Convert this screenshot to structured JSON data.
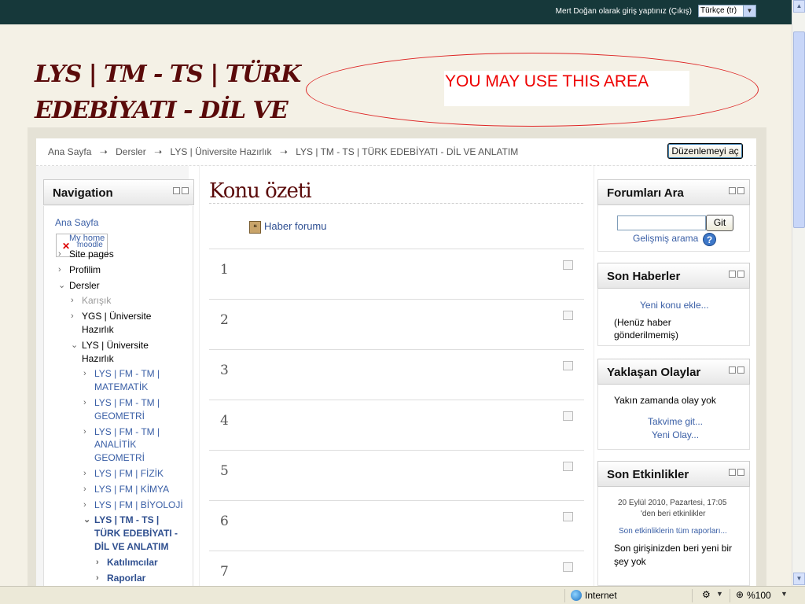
{
  "topbar": {
    "login_info": "Mert Doğan olarak giriş yaptınız (Çıkış)",
    "language": "Türkçe (tr)"
  },
  "header": {
    "site_title": "LYS | TM - TS | TÜRK EDEBİYATI - DİL VE",
    "ad_text": "YOU MAY USE THIS AREA"
  },
  "breadcrumb": [
    "Ana Sayfa",
    "Dersler",
    "LYS | Üniversite Hazırlık",
    "LYS | TM - TS | TÜRK EDEBİYATI - DİL VE ANLATIM"
  ],
  "breadcrumb_sep": "➝",
  "edit_button": "Düzenlemeyi aç",
  "navigation": {
    "title": "Navigation",
    "broken_image_alt": "moodle",
    "items": {
      "ana_sayfa": "Ana Sayfa",
      "my_home": "My home",
      "site_pages": "Site pages",
      "profilim": "Profilim",
      "dersler": "Dersler",
      "karisik": "Karışık",
      "ygs_1": "YGS | Üniversite",
      "ygs_2": "Hazırlık",
      "lys_1": "LYS | Üniversite",
      "lys_2": "Hazırlık",
      "mat_1": "LYS | FM - TM |",
      "mat_2": "MATEMATİK",
      "geo_1": "LYS | FM - TM |",
      "geo_2": "GEOMETRİ",
      "an_1": "LYS | FM - TM |",
      "an_2": "ANALİTİK",
      "an_3": "GEOMETRİ",
      "fizik": "LYS | FM | FİZİK",
      "kimya": "LYS | FM | KİMYA",
      "biyoloji": "LYS | FM | BİYOLOJİ",
      "edb_1": "LYS | TM - TS |",
      "edb_2": "TÜRK EDEBİYATI -",
      "edb_3": "DİL VE ANLATIM",
      "katilimcilar": "Katılımcılar",
      "raporlar": "Raporlar"
    }
  },
  "main": {
    "title": "Konu özeti",
    "forum_link": "Haber forumu",
    "sections": [
      "1",
      "2",
      "3",
      "4",
      "5",
      "6",
      "7"
    ]
  },
  "right": {
    "forum_search": {
      "title": "Forumları Ara",
      "button": "Git",
      "advanced": "Gelişmiş arama",
      "help": "?"
    },
    "news": {
      "title": "Son Haberler",
      "add": "Yeni konu ekle...",
      "empty_1": "(Henüz haber",
      "empty_2": "gönderilmemiş)"
    },
    "events": {
      "title": "Yaklaşan Olaylar",
      "none": "Yakın zamanda olay yok",
      "calendar": "Takvime git...",
      "new_event": "Yeni Olay..."
    },
    "activity": {
      "title": "Son Etkinlikler",
      "since_1": "20 Eylül 2010, Pazartesi, 17:05",
      "since_2": "'den beri etkinlikler",
      "full_report": "Son etkinliklerin tüm raporları...",
      "none_1": "Son girişinizden beri yeni bir",
      "none_2": "şey yok"
    }
  },
  "statusbar": {
    "zone": "Internet",
    "zoom": "%100"
  },
  "colors": {
    "topbar": "#16383a",
    "title": "#5a0a0a",
    "link": "#3a5fa6",
    "ad": "#ee0000"
  }
}
